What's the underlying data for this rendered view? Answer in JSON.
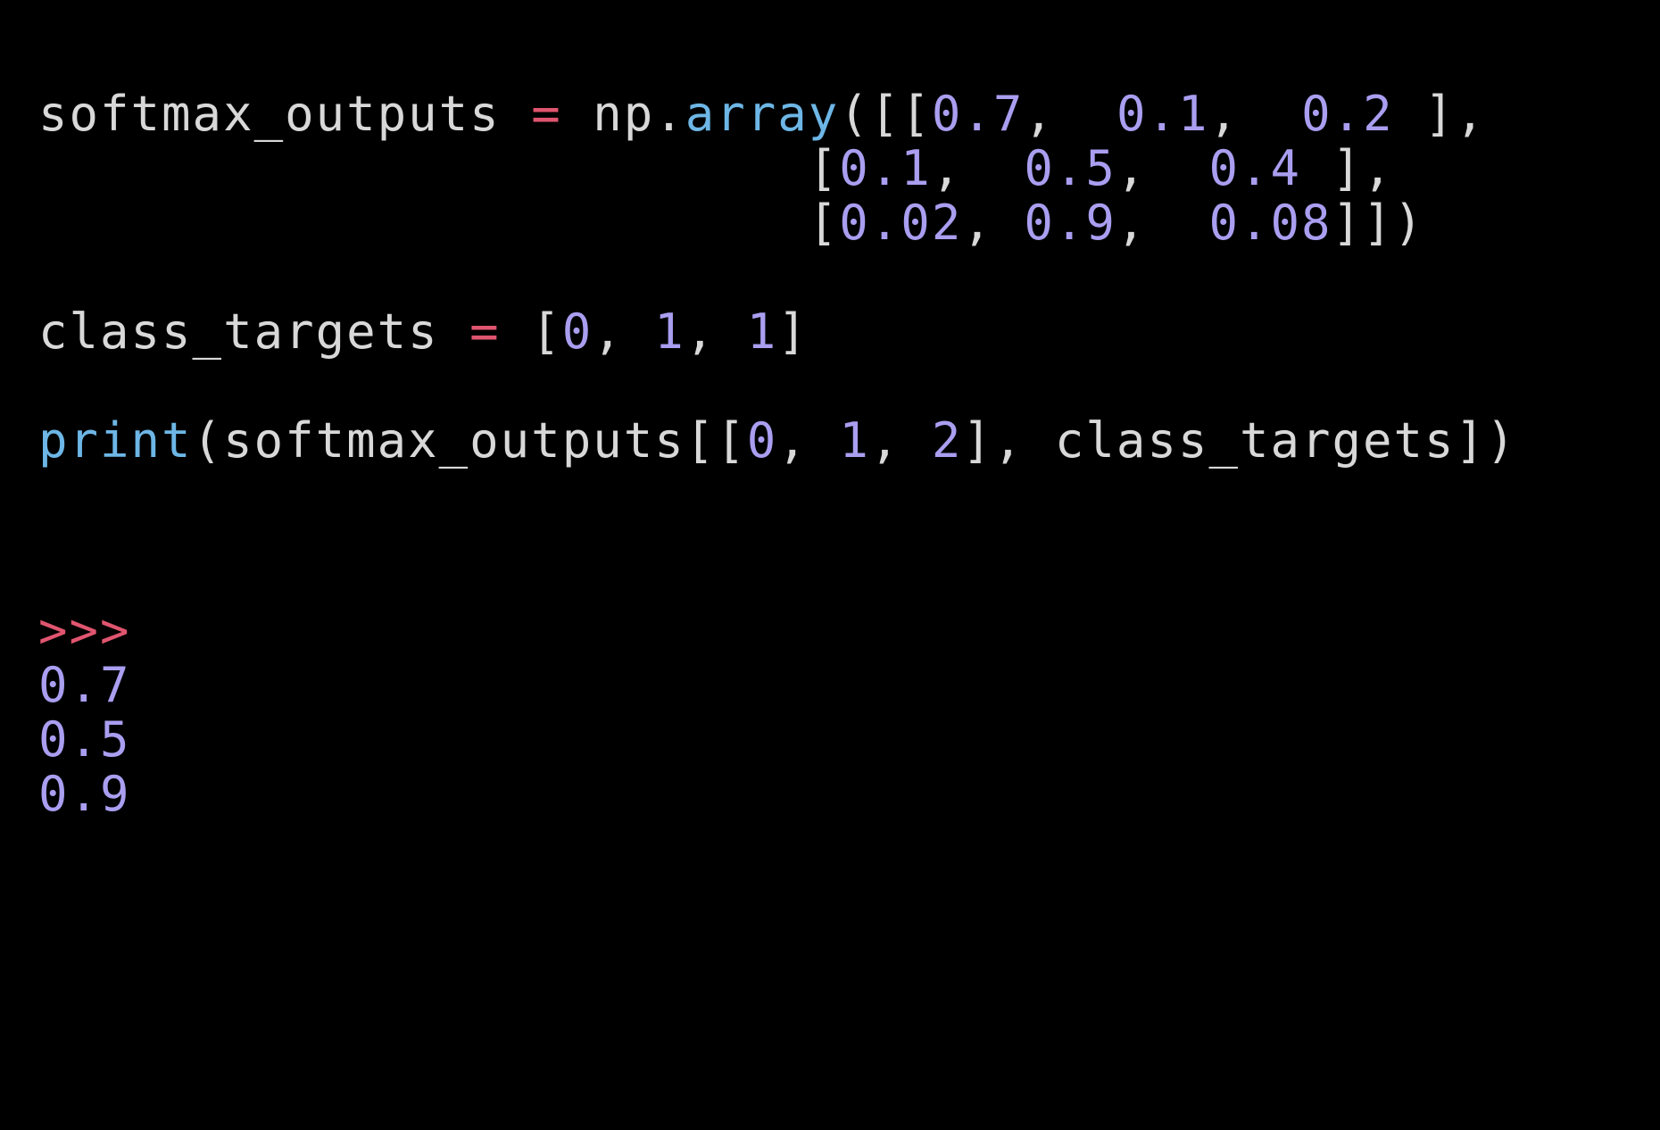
{
  "colors": {
    "background": "#000000",
    "identifier": "#d8d8d8",
    "operator": "#e0556f",
    "function": "#6db6e6",
    "number": "#a99ef0",
    "prompt": "#e0556f"
  },
  "code": {
    "line1": {
      "var": "softmax_outputs",
      "eq": "=",
      "module": "np.",
      "func": "array",
      "open": "([[",
      "r1c1": "0.7",
      "sep1": ",  ",
      "r1c2": "0.1",
      "sep2": ",  ",
      "r1c3": "0.2",
      "close": " ],"
    },
    "line2": {
      "indent": "                         [",
      "r2c1": "0.1",
      "sep1": ",  ",
      "r2c2": "0.5",
      "sep2": ",  ",
      "r2c3": "0.4",
      "close": " ],"
    },
    "line3": {
      "indent": "                         [",
      "r3c1": "0.02",
      "sep1": ", ",
      "r3c2": "0.9",
      "sep2": ",  ",
      "r3c3": "0.08",
      "close": "]])"
    },
    "line4": {
      "var": "class_targets",
      "eq": "=",
      "open": "[",
      "t1": "0",
      "sep1": ", ",
      "t2": "1",
      "sep2": ", ",
      "t3": "1",
      "close": "]"
    },
    "line5": {
      "func": "print",
      "open": "(softmax_outputs[[",
      "i1": "0",
      "sep1": ", ",
      "i2": "1",
      "sep2": ", ",
      "i3": "2",
      "mid": "], class_targets])"
    }
  },
  "output": {
    "prompt": ">>>",
    "values": [
      "0.7",
      "0.5",
      "0.9"
    ]
  }
}
